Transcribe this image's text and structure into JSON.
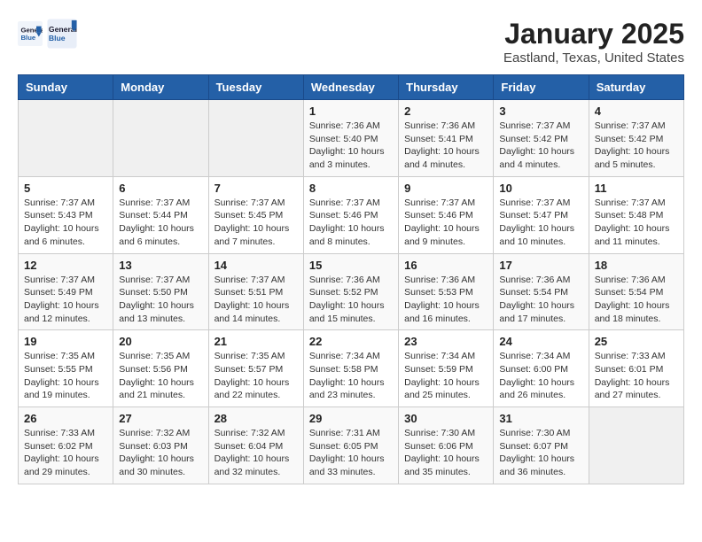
{
  "header": {
    "logo_line1": "General",
    "logo_line2": "Blue",
    "title": "January 2025",
    "subtitle": "Eastland, Texas, United States"
  },
  "days_of_week": [
    "Sunday",
    "Monday",
    "Tuesday",
    "Wednesday",
    "Thursday",
    "Friday",
    "Saturday"
  ],
  "weeks": [
    [
      {
        "day": "",
        "info": ""
      },
      {
        "day": "",
        "info": ""
      },
      {
        "day": "",
        "info": ""
      },
      {
        "day": "1",
        "info": "Sunrise: 7:36 AM\nSunset: 5:40 PM\nDaylight: 10 hours\nand 3 minutes."
      },
      {
        "day": "2",
        "info": "Sunrise: 7:36 AM\nSunset: 5:41 PM\nDaylight: 10 hours\nand 4 minutes."
      },
      {
        "day": "3",
        "info": "Sunrise: 7:37 AM\nSunset: 5:42 PM\nDaylight: 10 hours\nand 4 minutes."
      },
      {
        "day": "4",
        "info": "Sunrise: 7:37 AM\nSunset: 5:42 PM\nDaylight: 10 hours\nand 5 minutes."
      }
    ],
    [
      {
        "day": "5",
        "info": "Sunrise: 7:37 AM\nSunset: 5:43 PM\nDaylight: 10 hours\nand 6 minutes."
      },
      {
        "day": "6",
        "info": "Sunrise: 7:37 AM\nSunset: 5:44 PM\nDaylight: 10 hours\nand 6 minutes."
      },
      {
        "day": "7",
        "info": "Sunrise: 7:37 AM\nSunset: 5:45 PM\nDaylight: 10 hours\nand 7 minutes."
      },
      {
        "day": "8",
        "info": "Sunrise: 7:37 AM\nSunset: 5:46 PM\nDaylight: 10 hours\nand 8 minutes."
      },
      {
        "day": "9",
        "info": "Sunrise: 7:37 AM\nSunset: 5:46 PM\nDaylight: 10 hours\nand 9 minutes."
      },
      {
        "day": "10",
        "info": "Sunrise: 7:37 AM\nSunset: 5:47 PM\nDaylight: 10 hours\nand 10 minutes."
      },
      {
        "day": "11",
        "info": "Sunrise: 7:37 AM\nSunset: 5:48 PM\nDaylight: 10 hours\nand 11 minutes."
      }
    ],
    [
      {
        "day": "12",
        "info": "Sunrise: 7:37 AM\nSunset: 5:49 PM\nDaylight: 10 hours\nand 12 minutes."
      },
      {
        "day": "13",
        "info": "Sunrise: 7:37 AM\nSunset: 5:50 PM\nDaylight: 10 hours\nand 13 minutes."
      },
      {
        "day": "14",
        "info": "Sunrise: 7:37 AM\nSunset: 5:51 PM\nDaylight: 10 hours\nand 14 minutes."
      },
      {
        "day": "15",
        "info": "Sunrise: 7:36 AM\nSunset: 5:52 PM\nDaylight: 10 hours\nand 15 minutes."
      },
      {
        "day": "16",
        "info": "Sunrise: 7:36 AM\nSunset: 5:53 PM\nDaylight: 10 hours\nand 16 minutes."
      },
      {
        "day": "17",
        "info": "Sunrise: 7:36 AM\nSunset: 5:54 PM\nDaylight: 10 hours\nand 17 minutes."
      },
      {
        "day": "18",
        "info": "Sunrise: 7:36 AM\nSunset: 5:54 PM\nDaylight: 10 hours\nand 18 minutes."
      }
    ],
    [
      {
        "day": "19",
        "info": "Sunrise: 7:35 AM\nSunset: 5:55 PM\nDaylight: 10 hours\nand 19 minutes."
      },
      {
        "day": "20",
        "info": "Sunrise: 7:35 AM\nSunset: 5:56 PM\nDaylight: 10 hours\nand 21 minutes."
      },
      {
        "day": "21",
        "info": "Sunrise: 7:35 AM\nSunset: 5:57 PM\nDaylight: 10 hours\nand 22 minutes."
      },
      {
        "day": "22",
        "info": "Sunrise: 7:34 AM\nSunset: 5:58 PM\nDaylight: 10 hours\nand 23 minutes."
      },
      {
        "day": "23",
        "info": "Sunrise: 7:34 AM\nSunset: 5:59 PM\nDaylight: 10 hours\nand 25 minutes."
      },
      {
        "day": "24",
        "info": "Sunrise: 7:34 AM\nSunset: 6:00 PM\nDaylight: 10 hours\nand 26 minutes."
      },
      {
        "day": "25",
        "info": "Sunrise: 7:33 AM\nSunset: 6:01 PM\nDaylight: 10 hours\nand 27 minutes."
      }
    ],
    [
      {
        "day": "26",
        "info": "Sunrise: 7:33 AM\nSunset: 6:02 PM\nDaylight: 10 hours\nand 29 minutes."
      },
      {
        "day": "27",
        "info": "Sunrise: 7:32 AM\nSunset: 6:03 PM\nDaylight: 10 hours\nand 30 minutes."
      },
      {
        "day": "28",
        "info": "Sunrise: 7:32 AM\nSunset: 6:04 PM\nDaylight: 10 hours\nand 32 minutes."
      },
      {
        "day": "29",
        "info": "Sunrise: 7:31 AM\nSunset: 6:05 PM\nDaylight: 10 hours\nand 33 minutes."
      },
      {
        "day": "30",
        "info": "Sunrise: 7:30 AM\nSunset: 6:06 PM\nDaylight: 10 hours\nand 35 minutes."
      },
      {
        "day": "31",
        "info": "Sunrise: 7:30 AM\nSunset: 6:07 PM\nDaylight: 10 hours\nand 36 minutes."
      },
      {
        "day": "",
        "info": ""
      }
    ]
  ]
}
